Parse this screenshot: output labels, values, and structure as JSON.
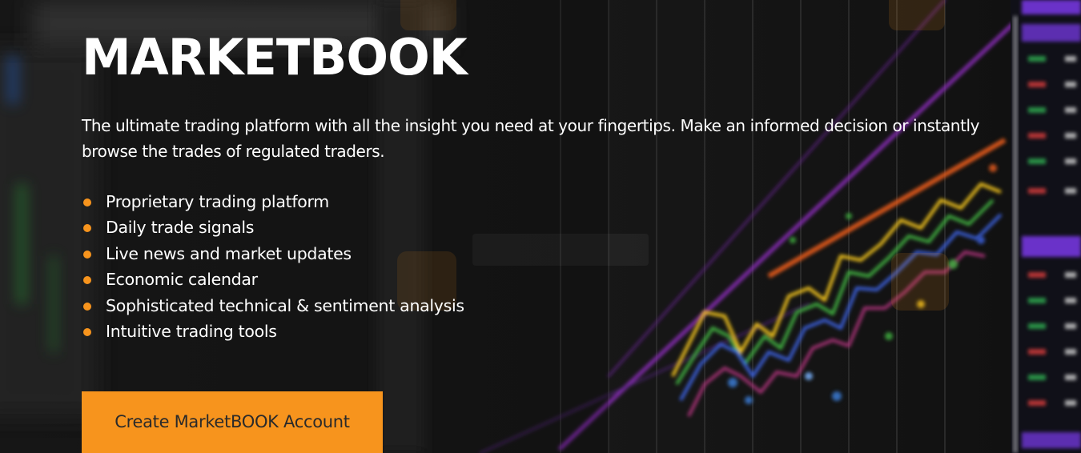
{
  "hero": {
    "title": "MARKETBOOK",
    "description": "The ultimate trading platform with all the insight you need at your fingertips. Make an informed decision or instantly browse the trades of regulated traders.",
    "features": [
      "Proprietary trading platform",
      "Daily trade signals",
      "Live news and market updates",
      "Economic calendar",
      "Sophisticated technical & sentiment analysis",
      "Intuitive trading tools"
    ],
    "cta_label": "Create MarketBOOK Account"
  },
  "colors": {
    "accent": "#f7941d",
    "background": "#161616",
    "text": "#ffffff",
    "button_text": "#2a2a2a"
  },
  "icons": {
    "bullet": "orange-dot",
    "watermark": "wikifx-logo"
  }
}
